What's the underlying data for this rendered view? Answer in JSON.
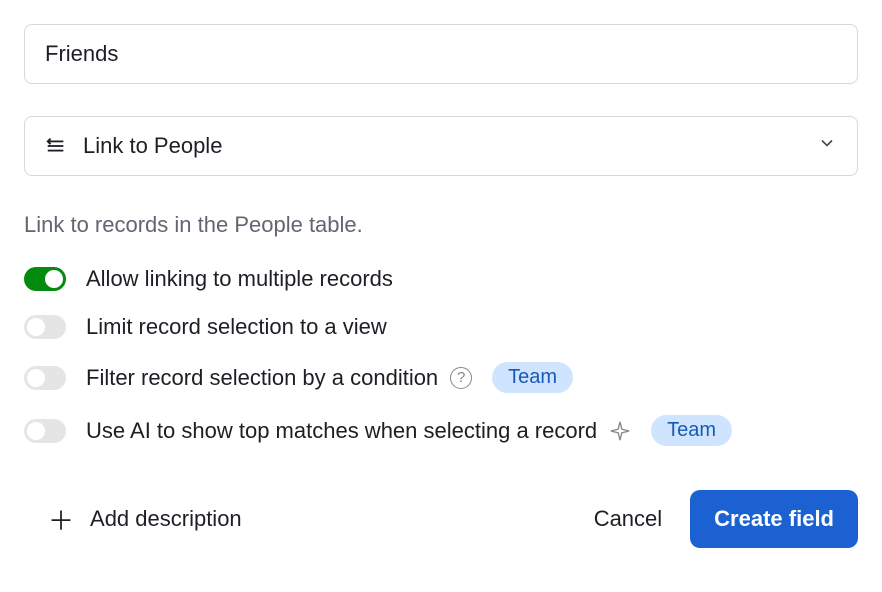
{
  "fieldName": "Friends",
  "fieldType": {
    "label": "Link to People"
  },
  "description": "Link to records in the People table.",
  "options": {
    "allowMultiple": {
      "label": "Allow linking to multiple records",
      "enabled": true
    },
    "limitToView": {
      "label": "Limit record selection to a view",
      "enabled": false
    },
    "filterByCondition": {
      "label": "Filter record selection by a condition",
      "enabled": false,
      "badge": "Team"
    },
    "aiTopMatches": {
      "label": "Use AI to show top matches when selecting a record",
      "enabled": false,
      "badge": "Team"
    }
  },
  "footer": {
    "addDescription": "Add description",
    "cancel": "Cancel",
    "create": "Create field"
  }
}
